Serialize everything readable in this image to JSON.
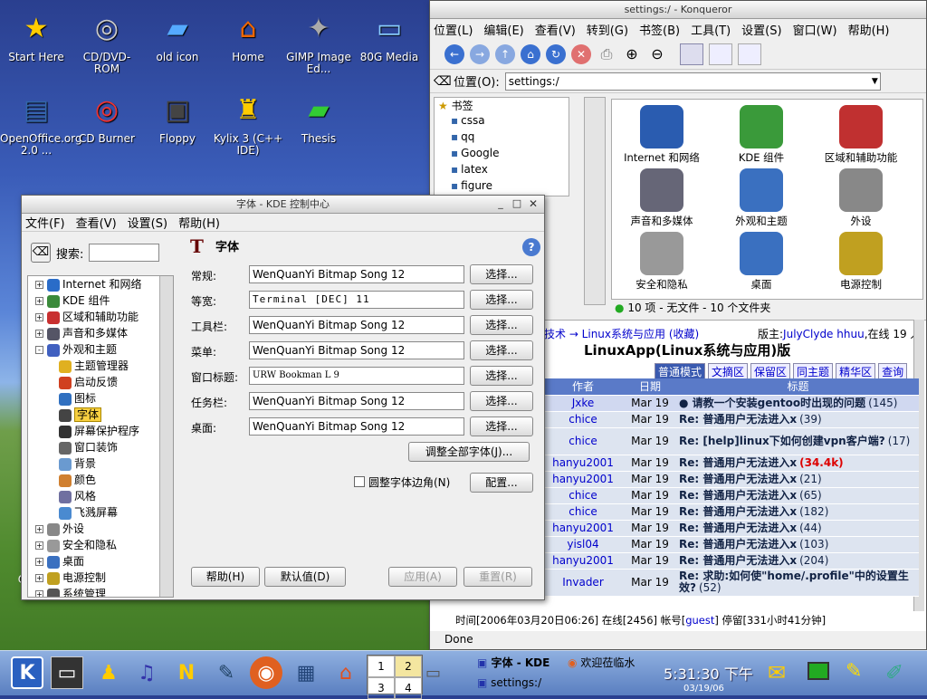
{
  "desktop": {
    "icons": [
      "Start Here",
      "CD/DVD-ROM",
      "old icon",
      "Home",
      "GIMP Image Ed...",
      "80G Media",
      "OpenOffice.org 2.0 ...",
      "CD Burner",
      "Floppy",
      "Kylix 3 (C++ IDE)",
      "Thesis",
      "Op org"
    ]
  },
  "konq": {
    "title": "settings:/ - Konqueror",
    "menu": [
      "位置(L)",
      "编辑(E)",
      "查看(V)",
      "转到(G)",
      "书签(B)",
      "工具(T)",
      "设置(S)",
      "窗口(W)",
      "帮助(H)"
    ],
    "loc_label": "位置(O):",
    "loc_value": "settings:/",
    "bookmarks_title": "书签",
    "bookmarks": [
      "cssa",
      "qq",
      "Google",
      "latex",
      "figure"
    ],
    "icons": [
      "Internet 和网络",
      "KDE 组件",
      "区域和辅助功能",
      "声音和多媒体",
      "外观和主题",
      "外设",
      "安全和隐私",
      "桌面",
      "电源控制"
    ],
    "status": "10 项 - 无文件 - 10 个文件夹",
    "done": "Done"
  },
  "forum": {
    "crumb": "技术 → Linux系统与应用 (收藏)",
    "mod_prefix": "版主:",
    "mod_names": "JulyClyde hhuu",
    "online": ",在线 19 人",
    "board": "LinuxApp(Linux系统与应用)版",
    "tabs": [
      "普通模式",
      "文摘区",
      "保留区",
      "同主题",
      "精华区",
      "查询"
    ],
    "headers": [
      "作者",
      "日期",
      "标题"
    ],
    "rows": [
      {
        "author": "Jxke",
        "date": "Mar 19",
        "title": "● 请教一个安装gentoo时出现的问题",
        "count": "(145)"
      },
      {
        "author": "chice",
        "date": "Mar 19",
        "title": "Re: 普通用户无法进入x",
        "count": "(39)"
      },
      {
        "author": "chice",
        "date": "Mar 19",
        "title": "Re: [help]linux下如何创建vpn客户端?",
        "count": "(17)"
      },
      {
        "author": "hanyu2001",
        "date": "Mar 19",
        "title": "Re: 普通用户无法进入x",
        "count": "(34.4k)"
      },
      {
        "author": "hanyu2001",
        "date": "Mar 19",
        "title": "Re: 普通用户无法进入x",
        "count": "(21)"
      },
      {
        "author": "chice",
        "date": "Mar 19",
        "title": "Re: 普通用户无法进入x",
        "count": "(65)"
      },
      {
        "author": "chice",
        "date": "Mar 19",
        "title": "Re: 普通用户无法进入x",
        "count": "(182)"
      },
      {
        "author": "hanyu2001",
        "date": "Mar 19",
        "title": "Re: 普通用户无法进入x",
        "count": "(44)"
      },
      {
        "author": "yisl04",
        "date": "Mar 19",
        "title": "Re: 普通用户无法进入x",
        "count": "(103)"
      },
      {
        "author": "hanyu2001",
        "date": "Mar 19",
        "title": "Re: 普通用户无法进入x",
        "count": "(204)"
      },
      {
        "author": "Invader",
        "date": "Mar 19",
        "title": "Re: 求助:如何使\"home/.profile\"中的设置生效?",
        "count": "(52)"
      }
    ],
    "footer_pre": "时间[2006年03月20日06:26] 在线[2456] 帐号[",
    "footer_user": "guest",
    "footer_post": "] 停留[331小时41分钟]"
  },
  "kcc": {
    "title": "字体 - KDE 控制中心",
    "menu": [
      "文件(F)",
      "查看(V)",
      "设置(S)",
      "帮助(H)"
    ],
    "search_label": "搜索:",
    "page_title": "字体",
    "tree": [
      {
        "label": "Internet 和网络",
        "lvl": 0,
        "ex": "+",
        "c": "#2a6cc8"
      },
      {
        "label": "KDE 组件",
        "lvl": 0,
        "ex": "+",
        "c": "#3a8a3a"
      },
      {
        "label": "区域和辅助功能",
        "lvl": 0,
        "ex": "+",
        "c": "#c83030"
      },
      {
        "label": "声音和多媒体",
        "lvl": 0,
        "ex": "+",
        "c": "#556"
      },
      {
        "label": "外观和主题",
        "lvl": 0,
        "ex": "-",
        "c": "#4060c0"
      },
      {
        "label": "主题管理器",
        "lvl": 1,
        "c": "#e0b020"
      },
      {
        "label": "启动反馈",
        "lvl": 1,
        "c": "#d04020"
      },
      {
        "label": "图标",
        "lvl": 1,
        "c": "#3070c0"
      },
      {
        "label": "字体",
        "lvl": 1,
        "c": "#444",
        "sel": true
      },
      {
        "label": "屏幕保护程序",
        "lvl": 1,
        "c": "#333"
      },
      {
        "label": "窗口装饰",
        "lvl": 1,
        "c": "#666"
      },
      {
        "label": "背景",
        "lvl": 1,
        "c": "#6a9ad0"
      },
      {
        "label": "颜色",
        "lvl": 1,
        "c": "#d08030"
      },
      {
        "label": "风格",
        "lvl": 1,
        "c": "#7070a0"
      },
      {
        "label": "飞溅屏幕",
        "lvl": 1,
        "c": "#4a8ad0"
      },
      {
        "label": "外设",
        "lvl": 0,
        "ex": "+",
        "c": "#888"
      },
      {
        "label": "安全和隐私",
        "lvl": 0,
        "ex": "+",
        "c": "#999"
      },
      {
        "label": "桌面",
        "lvl": 0,
        "ex": "+",
        "c": "#3a70c0"
      },
      {
        "label": "电源控制",
        "lvl": 0,
        "ex": "+",
        "c": "#c0a020"
      },
      {
        "label": "系统管理",
        "lvl": 0,
        "ex": "+",
        "c": "#555"
      }
    ],
    "fonts": [
      {
        "label": "常规:",
        "value": "WenQuanYi Bitmap Song 12",
        "btn": "选择..."
      },
      {
        "label": "等宽:",
        "value": "Terminal [DEC] 11",
        "btn": "选择...",
        "mono": true
      },
      {
        "label": "工具栏:",
        "value": "WenQuanYi Bitmap Song 12",
        "btn": "选择..."
      },
      {
        "label": "菜单:",
        "value": "WenQuanYi Bitmap Song 12",
        "btn": "选择..."
      },
      {
        "label": "窗口标题:",
        "value": "URW Bookman L 9",
        "btn": "选择...",
        "serif": true
      },
      {
        "label": "任务栏:",
        "value": "WenQuanYi Bitmap Song 12",
        "btn": "选择..."
      },
      {
        "label": "桌面:",
        "value": "WenQuanYi Bitmap Song 12",
        "btn": "选择..."
      }
    ],
    "adjust_all": "调整全部字体(J)...",
    "antialias": "圆整字体边角(N)",
    "config": "配置...",
    "help": "帮助(H)",
    "defaults": "默认值(D)",
    "apply": "应用(A)",
    "reset": "重置(R)"
  },
  "taskbar": {
    "pager": [
      "1",
      "2",
      "3",
      "4"
    ],
    "task1": "字体 - KDE",
    "task2": "欢迎莅临水",
    "task3": "settings:/",
    "clock": "5:31:30 下午",
    "date": "03/19/06"
  }
}
